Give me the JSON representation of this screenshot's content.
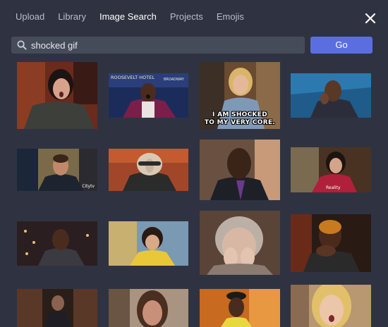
{
  "tabs": [
    {
      "label": "Upload",
      "active": false
    },
    {
      "label": "Library",
      "active": false
    },
    {
      "label": "Image Search",
      "active": true
    },
    {
      "label": "Projects",
      "active": false
    },
    {
      "label": "Emojis",
      "active": false
    }
  ],
  "search": {
    "value": "shocked gif",
    "button_label": "Go"
  },
  "results": [
    {
      "name": "result-gasping-woman-cafe"
    },
    {
      "name": "result-shocked-man-hotel",
      "sign": "ROOSEVELT HOTEL",
      "sign2": "BROADWAY"
    },
    {
      "name": "result-shocked-to-my-core",
      "caption": "I AM SHOCKED\nTO MY VERY CORE."
    },
    {
      "name": "result-man-hand-on-face"
    },
    {
      "name": "result-shocked-man-dark-shirt",
      "tag": "Citytv"
    },
    {
      "name": "result-gru-shocked"
    },
    {
      "name": "result-man-purple-tie"
    },
    {
      "name": "result-woman-gasp-window",
      "tag": "Reality"
    },
    {
      "name": "result-man-open-mouth-lights"
    },
    {
      "name": "result-girl-yellow-top"
    },
    {
      "name": "result-elderly-woman-hands-face"
    },
    {
      "name": "result-woman-covering-mouth"
    },
    {
      "name": "result-man-in-doorway"
    },
    {
      "name": "result-woman-shocked-closeup"
    },
    {
      "name": "result-man-in-hat"
    },
    {
      "name": "result-blonde-girl-shocked"
    }
  ]
}
